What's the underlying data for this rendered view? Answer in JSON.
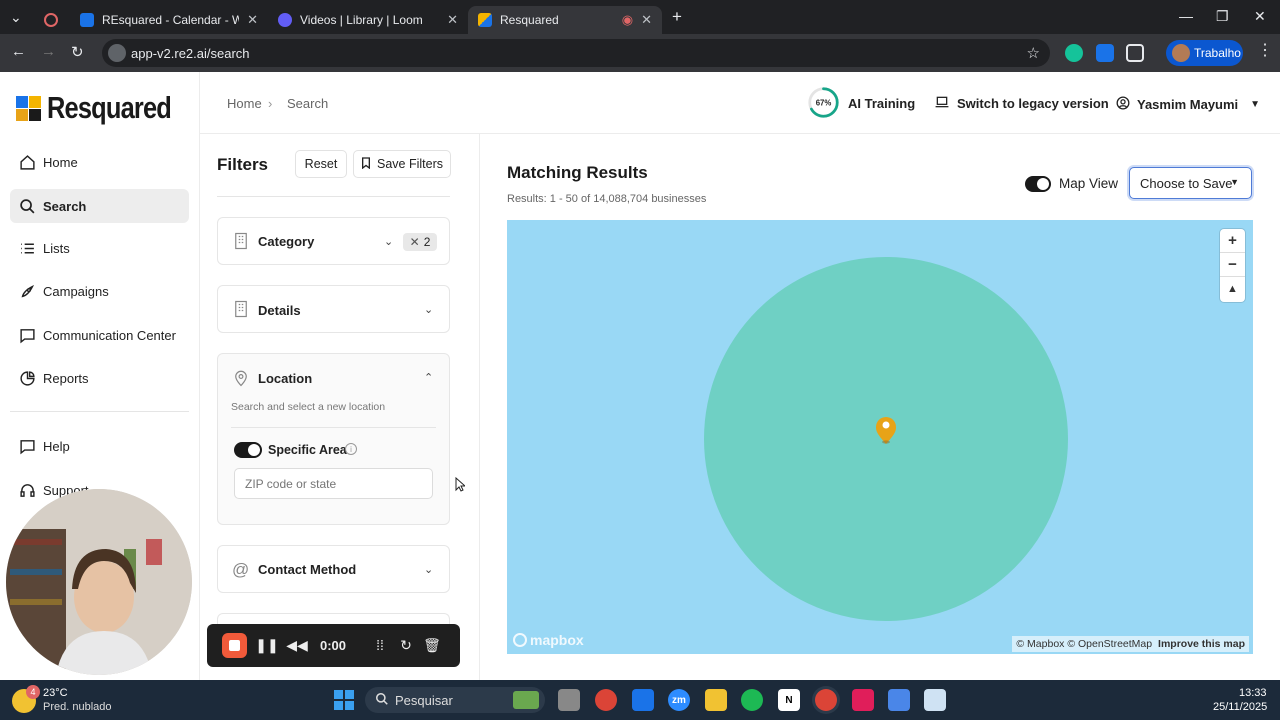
{
  "browser": {
    "tabs": [
      {
        "title": "REsquared - Calendar - Week o",
        "color": "#1a73e8"
      },
      {
        "title": "Videos | Library | Loom",
        "color": "#625df5"
      },
      {
        "title": "Resquared",
        "color": "#f4b400"
      }
    ],
    "url": "app-v2.re2.ai/search",
    "profile": "Trabalho"
  },
  "app": {
    "logo_text": "Resquared",
    "nav": [
      {
        "label": "Home",
        "icon": "home-icon"
      },
      {
        "label": "Search",
        "icon": "search-icon"
      },
      {
        "label": "Lists",
        "icon": "list-icon"
      },
      {
        "label": "Campaigns",
        "icon": "rocket-icon"
      },
      {
        "label": "Communication Center",
        "icon": "chat-icon"
      },
      {
        "label": "Reports",
        "icon": "pie-chart-icon"
      }
    ],
    "nav_bottom": [
      {
        "label": "Help",
        "icon": "help-icon"
      },
      {
        "label": "Support",
        "icon": "headset-icon"
      }
    ]
  },
  "header": {
    "breadcrumb": [
      "Home",
      "Search"
    ],
    "ai_training_label": "AI Training",
    "ai_progress_text": "67%",
    "ai_progress": 0.67,
    "legacy_label": "Switch to legacy version",
    "user_name": "Yasmim Mayumi"
  },
  "filters": {
    "title": "Filters",
    "reset_label": "Reset",
    "save_label": "Save Filters",
    "category": {
      "title": "Category",
      "badge": "2"
    },
    "details": {
      "title": "Details"
    },
    "location": {
      "title": "Location",
      "hint": "Search and select a new location",
      "specific_area_label": "Specific Area",
      "specific_area_on": true,
      "zip_placeholder": "ZIP code or state"
    },
    "contact": {
      "title": "Contact Method"
    }
  },
  "results": {
    "title": "Matching Results",
    "summary": "Results: 1 - 50 of 14,088,704 businesses",
    "map_view_label": "Map View",
    "map_view_on": true,
    "choose_label": "Choose to Save",
    "map_attribution_1": "© Mapbox © OpenStreetMap",
    "map_attribution_2": "Improve this map",
    "mapbox_label": "mapbox",
    "colors": {
      "water": "#99d8f5",
      "area": "#6fd0c4",
      "pin": "#e8a317"
    }
  },
  "recorder": {
    "time": "0:00"
  },
  "taskbar": {
    "weather_temp": "23°C",
    "weather_desc": "Pred. nublado",
    "weather_badge": "4",
    "search_label": "Pesquisar",
    "time": "13:33",
    "date": "25/11/2025"
  }
}
